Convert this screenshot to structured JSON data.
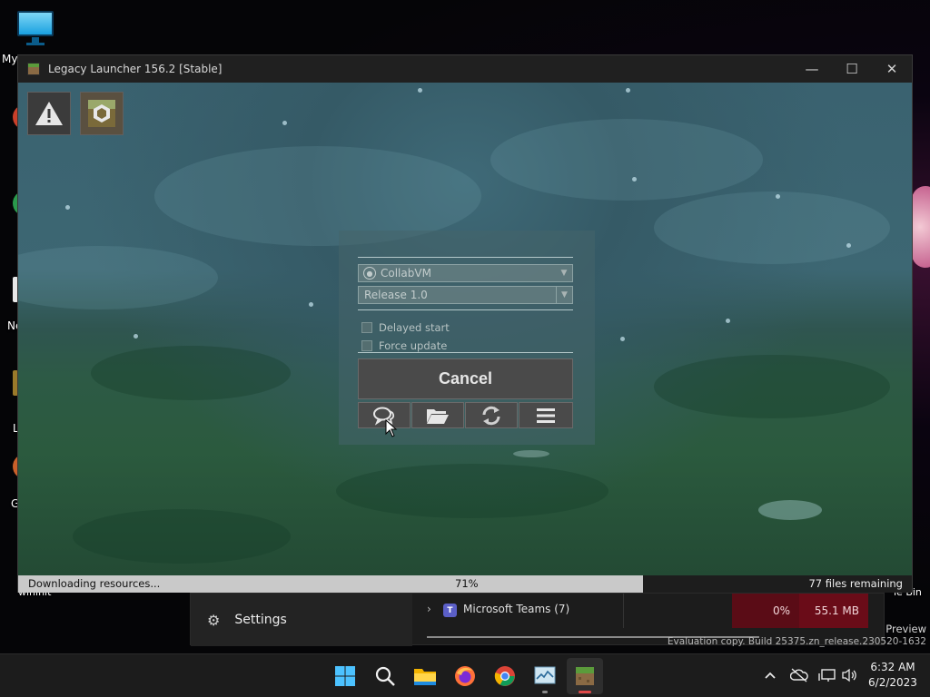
{
  "desktop": {
    "icons": [
      {
        "label": "My",
        "icon": "monitor-icon"
      },
      {
        "label": "wininit",
        "icon": "file-icon"
      },
      {
        "label": "Ne",
        "icon": "file-icon"
      },
      {
        "label": "L",
        "icon": "file-icon"
      },
      {
        "label": "G",
        "icon": "file-icon"
      },
      {
        "label": "le Bin",
        "icon": "recycle-bin-icon"
      }
    ]
  },
  "window": {
    "title": "Legacy Launcher 156.2 [Stable]",
    "controls": {
      "minimize": "—",
      "maximize": "☐",
      "close": "✕"
    }
  },
  "launcher": {
    "top_buttons": [
      {
        "name": "warning",
        "icon": "warning-icon"
      },
      {
        "name": "modpack",
        "icon": "minecraft-block-icon"
      }
    ],
    "account_select": {
      "value": "CollabVM",
      "icon": "user-icon"
    },
    "version_select": {
      "value": "Release 1.0"
    },
    "checkboxes": [
      {
        "label": "Delayed start",
        "checked": false
      },
      {
        "label": "Force update",
        "checked": false
      }
    ],
    "cancel_label": "Cancel",
    "toolbar": [
      {
        "name": "chat",
        "icon": "chat-bubbles-icon"
      },
      {
        "name": "folder",
        "icon": "folder-icon"
      },
      {
        "name": "refresh",
        "icon": "refresh-icon"
      },
      {
        "name": "menu",
        "icon": "menu-icon"
      }
    ]
  },
  "progress": {
    "status": "Downloading resources...",
    "percent_label": "71%",
    "percent": 71,
    "remaining": "77 files remaining"
  },
  "background": {
    "settings_label": "Settings",
    "row_label": "Microsoft Teams (7)",
    "cpu": "0%",
    "memory": "55.1 MB",
    "watermark_line1": "Preview",
    "watermark_line2": "Evaluation copy. Build 25375.zn_release.230520-1632"
  },
  "taskbar": {
    "time": "6:32 AM",
    "date": "6/2/2023",
    "apps": [
      {
        "name": "start",
        "icon": "windows-start-icon"
      },
      {
        "name": "search",
        "icon": "search-icon"
      },
      {
        "name": "file-explorer",
        "icon": "folder-icon"
      },
      {
        "name": "firefox",
        "icon": "firefox-icon"
      },
      {
        "name": "chrome",
        "icon": "chrome-icon"
      },
      {
        "name": "task-manager",
        "icon": "task-manager-icon"
      },
      {
        "name": "legacy-launcher",
        "icon": "minecraft-block-icon"
      }
    ],
    "tray": [
      "chevron-up-icon",
      "cloud-off-icon",
      "network-icon",
      "volume-icon"
    ]
  },
  "colors": {
    "progress_fill": "#c9c9c9",
    "teams_purple": "#5b5fc7",
    "cpu_cell": "#5a0c16"
  }
}
